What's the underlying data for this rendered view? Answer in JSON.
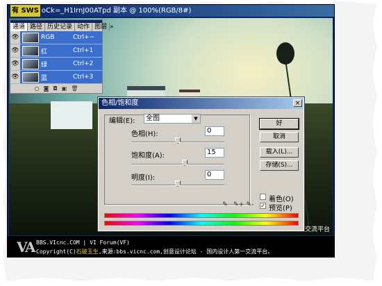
{
  "document": {
    "badge": "有 SWS",
    "title": "oCk=_H1IrnJ00ATpd 副本 @ 100%(RGB/8#)",
    "watermark": "人交流平台"
  },
  "channels_panel": {
    "tabs": [
      "通道",
      "路径",
      "历史记录",
      "动作",
      "图层"
    ],
    "menu_arrow": "»",
    "channels": [
      {
        "name": "RGB",
        "shortcut": "Ctrl+~"
      },
      {
        "name": "红",
        "shortcut": "Ctrl+1"
      },
      {
        "name": "绿",
        "shortcut": "Ctrl+2"
      },
      {
        "name": "蓝",
        "shortcut": "Ctrl+3"
      }
    ],
    "eye_glyph": "👁",
    "footer_icons": [
      "○",
      "◙",
      "◘",
      "▣",
      "🗑"
    ]
  },
  "dialog": {
    "title": "色相/饱和度",
    "close": "×",
    "edit_label": "编辑(E):",
    "edit_value": "全图",
    "hue_label": "色相(H):",
    "hue_value": "0",
    "hue_level": 0.5,
    "saturation_label": "饱和度(A):",
    "saturation_value": "15",
    "saturation_level": 0.575,
    "lightness_label": "明度(I):",
    "lightness_value": "0",
    "lightness_level": 0.5,
    "ok": "好",
    "cancel": "取消",
    "load": "载入(L)...",
    "save": "存储(S)...",
    "colorize_label": "着色(O)",
    "colorize_checked": false,
    "preview_label": "预览(P)",
    "preview_checked": true,
    "eyedroppers": [
      "✎",
      "✎+",
      "✎-"
    ]
  },
  "banner": {
    "logo": "VA",
    "line1": "BBS.VIcnc.COM | VI Forum(VF)",
    "line2_prefix": "Copyright(C)",
    "line2_highlight": "石破玉生",
    "line2_suffix": ",来源:bbs.vicnc.com,创意设计论坛 - 国内设计人第一交流平台。"
  }
}
